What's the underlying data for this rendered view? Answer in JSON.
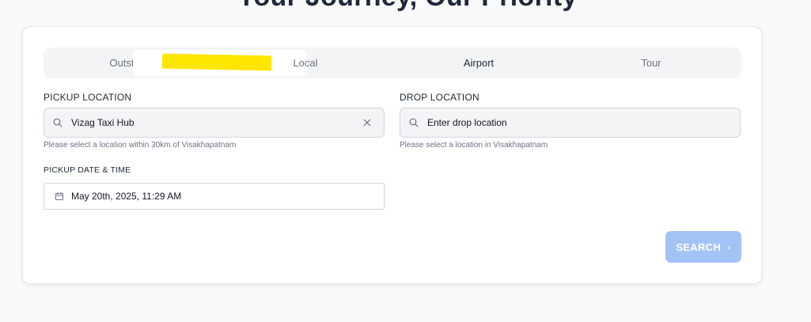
{
  "hero": {
    "title": "Your Journey, Our Priority"
  },
  "tabs": [
    {
      "label": "Outstation"
    },
    {
      "label": "Local"
    },
    {
      "label": "Airport"
    },
    {
      "label": "Tour"
    }
  ],
  "pickup": {
    "label": "PICKUP LOCATION",
    "value": "Vizag Taxi Hub",
    "hint": "Please select a location within 30km of Visakhapatnam"
  },
  "drop": {
    "label": "DROP LOCATION",
    "placeholder": "Enter drop location",
    "hint": "Please select a location in Visakhapatnam"
  },
  "datetime": {
    "label": "PICKUP DATE & TIME",
    "value": "May 20th, 2025, 11:29 AM"
  },
  "search": {
    "label": "SEARCH",
    "chevron": "›"
  },
  "colors": {
    "accent_disabled": "#a3c3f7",
    "redaction": "#ffe600"
  }
}
